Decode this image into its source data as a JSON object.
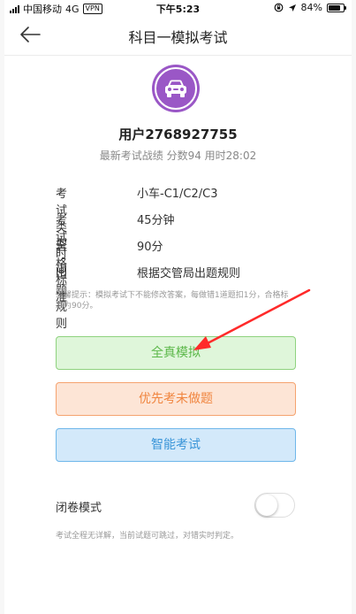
{
  "status_bar": {
    "carrier": "中国移动",
    "network": "4G",
    "vpn": "VPN",
    "time": "下午5:23",
    "battery": "84%",
    "battery_level": 0.84,
    "location_icon": "location-arrow-icon",
    "lock_icon": "rotation-lock-icon"
  },
  "nav": {
    "title": "科目一模拟考试",
    "back_icon": "back-arrow-icon"
  },
  "profile": {
    "avatar_icon": "car-icon",
    "avatar_color": "#9a57c6",
    "username": "用户2768927755",
    "latest_record": "最新考试战绩  分数94  用时28:02"
  },
  "info": [
    {
      "label": "考试类型",
      "value": "小车-C1/C2/C3"
    },
    {
      "label": "考试时间",
      "value": "45分钟"
    },
    {
      "label": "合格标准",
      "value": "90分"
    },
    {
      "label": "出题规则",
      "value": "根据交管局出题规则"
    }
  ],
  "tip": "温馨提示：模拟考试下不能修改答案，每做错1道题扣1分，合格标准为90分。",
  "buttons": {
    "real": "全真模拟",
    "undone": "优先考未做题",
    "smart": "智能考试"
  },
  "closed_mode": {
    "label": "闭卷模式",
    "enabled": false,
    "description": "考试全程无详解，当前试题可跳过，对错实时判定。"
  },
  "colors": {
    "accent_green": "#5cb84a",
    "accent_orange": "#f0853f",
    "accent_blue": "#3a95d8",
    "annotation_arrow": "#ff2a2a"
  }
}
